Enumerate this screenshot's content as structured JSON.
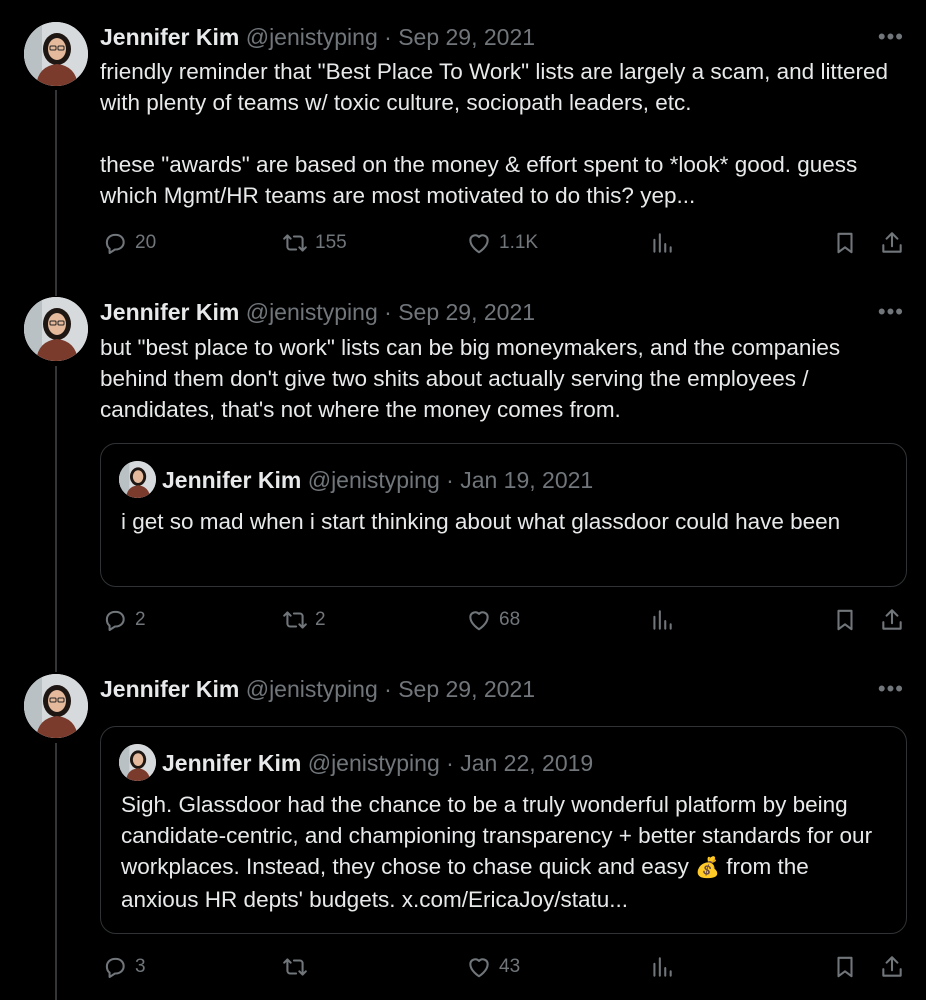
{
  "tweets": [
    {
      "name": "Jennifer Kim",
      "handle": "@jenistyping",
      "date": "Sep 29, 2021",
      "text": "friendly reminder that \"Best Place To Work\" lists are largely a scam, and littered with plenty of teams w/ toxic culture, sociopath leaders, etc.\n\nthese \"awards\" are based on the money & effort spent to *look* good. guess which Mgmt/HR teams are most motivated to do this? yep...",
      "replies": "20",
      "retweets": "155",
      "likes": "1.1K"
    },
    {
      "name": "Jennifer Kim",
      "handle": "@jenistyping",
      "date": "Sep 29, 2021",
      "text": "but \"best place to work\" lists can be big moneymakers, and the companies behind them don't give two shits about actually serving the employees / candidates, that's not where the money comes from.",
      "quote": {
        "name": "Jennifer Kim",
        "handle": "@jenistyping",
        "date": "Jan 19, 2021",
        "text": "i get so mad when i start thinking about what glassdoor could have been"
      },
      "replies": "2",
      "retweets": "2",
      "likes": "68"
    },
    {
      "name": "Jennifer Kim",
      "handle": "@jenistyping",
      "date": "Sep 29, 2021",
      "quote": {
        "name": "Jennifer Kim",
        "handle": "@jenistyping",
        "date": "Jan 22, 2019",
        "text_before_emoji": "Sigh. Glassdoor had the chance to be a truly wonderful platform by being candidate-centric, and championing transparency + better standards for our workplaces. Instead, they chose to chase quick and easy ",
        "emoji": "💰",
        "text_after_emoji": " from the anxious HR depts' budgets. x.com/EricaJoy/statu..."
      },
      "replies": "3",
      "retweets": "",
      "likes": "43"
    }
  ],
  "separator": " · ",
  "more_glyph": "•••"
}
